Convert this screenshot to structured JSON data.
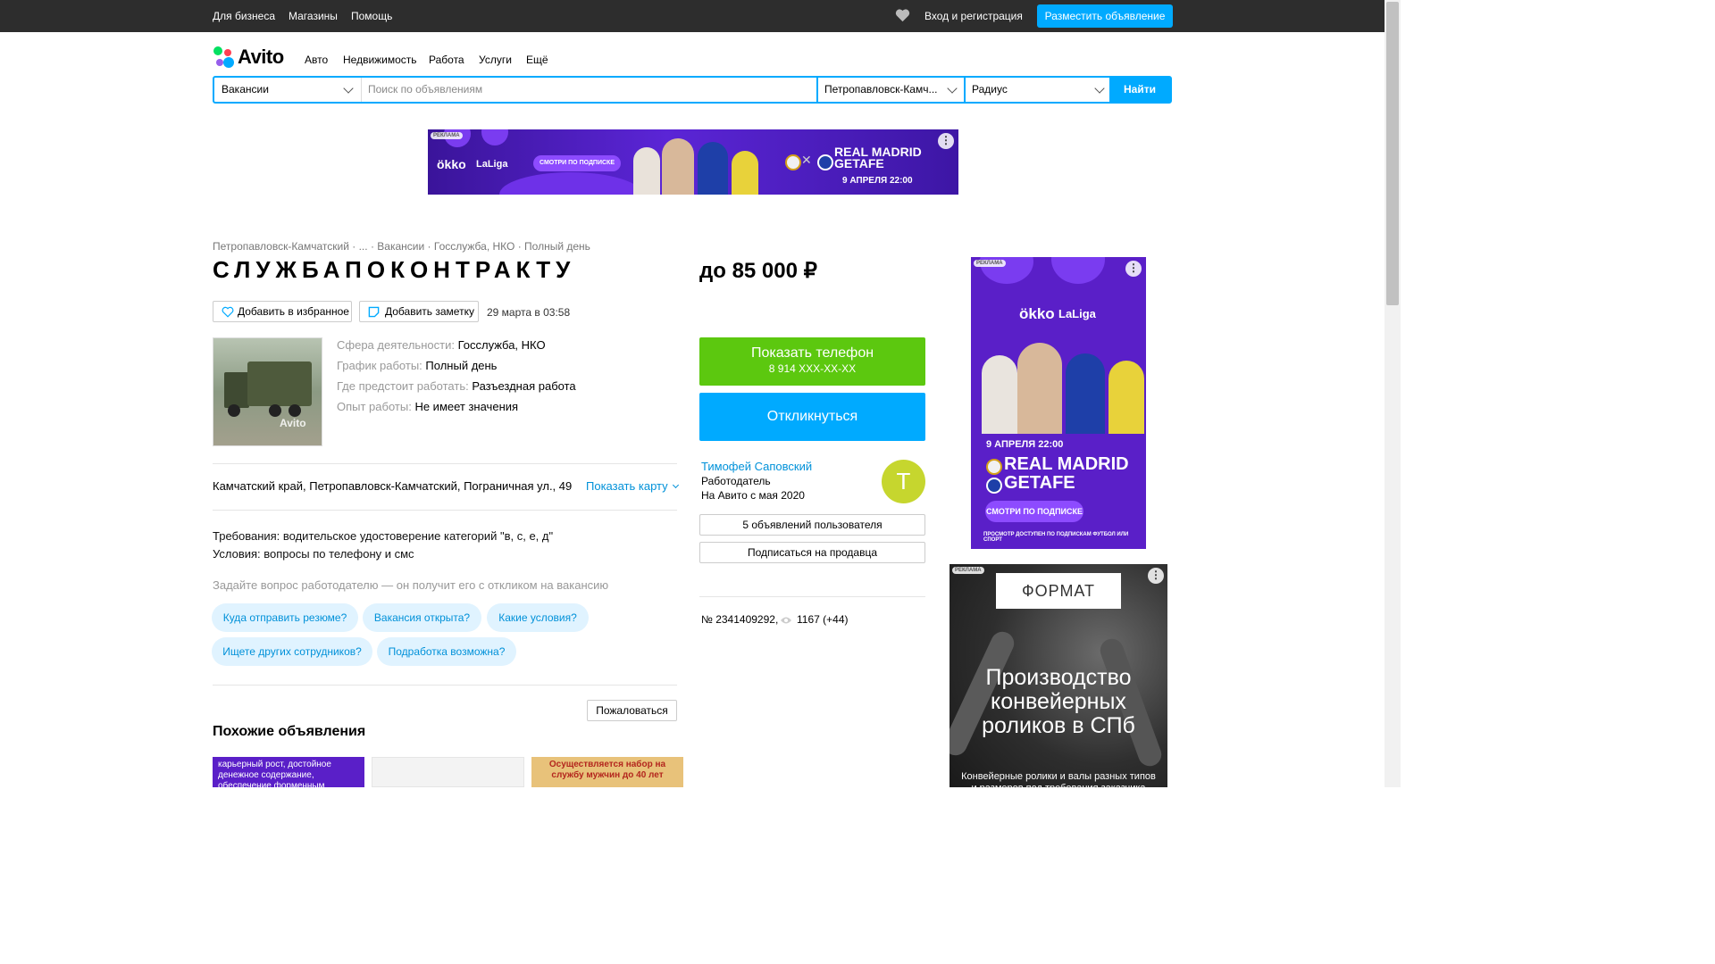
{
  "topbar": {
    "links": [
      "Для бизнеса",
      "Магазины",
      "Помощь"
    ],
    "login": "Вход и регистрация",
    "post_button": "Разместить объявление"
  },
  "logo_text": "Avito",
  "nav": [
    "Авто",
    "Недвижимость",
    "Работа",
    "Услуги",
    "Ещё"
  ],
  "search": {
    "category": "Вакансии",
    "placeholder": "Поиск по объявлениям",
    "city": "Петропавловск-Камч...",
    "radius": "Радиус",
    "button": "Найти"
  },
  "banner_top": {
    "label": "РЕКЛАМА",
    "brand": "ökko",
    "league": "LaLiga",
    "cta": "СМОТРИ ПО ПОДПИСКЕ",
    "team1": "REAL MADRID",
    "team2": "GETAFE",
    "date": "9 АПРЕЛЯ 22:00"
  },
  "breadcrumb": [
    "Петропавловск-Камчатский",
    "...",
    "Вакансии",
    "Госслужба, НКО",
    "Полный день"
  ],
  "listing": {
    "title": "СЛУЖБАПОКОНТРАКТУ",
    "fav_button": "Добавить в избранное",
    "note_button": "Добавить заметку",
    "date": "29 марта в 03:58",
    "photo_watermark": "Avito",
    "props": [
      {
        "k": "Сфера деятельности:",
        "v": "Госслужба, НКО"
      },
      {
        "k": "График работы:",
        "v": "Полный день"
      },
      {
        "k": "Где предстоит работать:",
        "v": "Разъездная работа"
      },
      {
        "k": "Опыт работы:",
        "v": "Не имеет значения"
      }
    ],
    "address": "Камчатский край, Петропавловск-Камчатский, Пограничная ул., 49",
    "show_map": "Показать карту",
    "req": "Требования: водительское удостоверение категорий \"в, с, е, д\"",
    "cond": "Условия: вопросы по телефону и смс",
    "ask_hint": "Задайте вопрос работодателю — он получит его с откликом на вакансию",
    "chips": [
      "Куда отправить резюме?",
      "Вакансия открыта?",
      "Какие условия?",
      "Ищете других сотрудников?",
      "Подработка возможна?"
    ],
    "complain": "Пожаловаться",
    "similar_title": "Похожие объявления",
    "similar_1_text": "карьерный рост, достойное денежное содержание, обеспечение форменным",
    "similar_3_text": "Осуществляется набор на службу мужчин до 40 лет"
  },
  "sidebar": {
    "price": "до 85 000 ₽",
    "phone_button": "Показать телефон",
    "phone_number": "8 914 XXX-XX-XX",
    "respond_button": "Откликнуться",
    "seller_name": "Тимофей Саповский",
    "seller_role": "Работодатель",
    "seller_since": "На Авито с мая 2020",
    "avatar_letter": "Т",
    "ads_button": "5 объявлений пользователя",
    "subscribe_button": "Подписаться на продавца",
    "item_id": "№ 2341409292,",
    "views": "1167 (+44)"
  },
  "ad_side1": {
    "label": "РЕКЛАМА",
    "brand": "ökko",
    "league": "LaLiga",
    "date": "9 АПРЕЛЯ 22:00",
    "team1": "REAL MADRID",
    "team2": "GETAFE",
    "cta": "СМОТРИ ПО ПОДПИСКЕ",
    "footer": "ПРОСМОТР ДОСТУПЕН ПО ПОДПИСКАМ ФУТБОЛ ИЛИ СПОРТ"
  },
  "ad_side2": {
    "label": "РЕКЛАМА",
    "logo": "ФОРМАТ",
    "headline": "Производство конвейерных роликов в СПб",
    "sub": "Конвейерные ролики и валы разных типов и размеров под требования заказчика"
  },
  "colors": {
    "accent": "#00aaff",
    "phone_green": "#5cc80f",
    "avatar": "#c6d62e",
    "ad_purple": "#5a1fc8"
  }
}
